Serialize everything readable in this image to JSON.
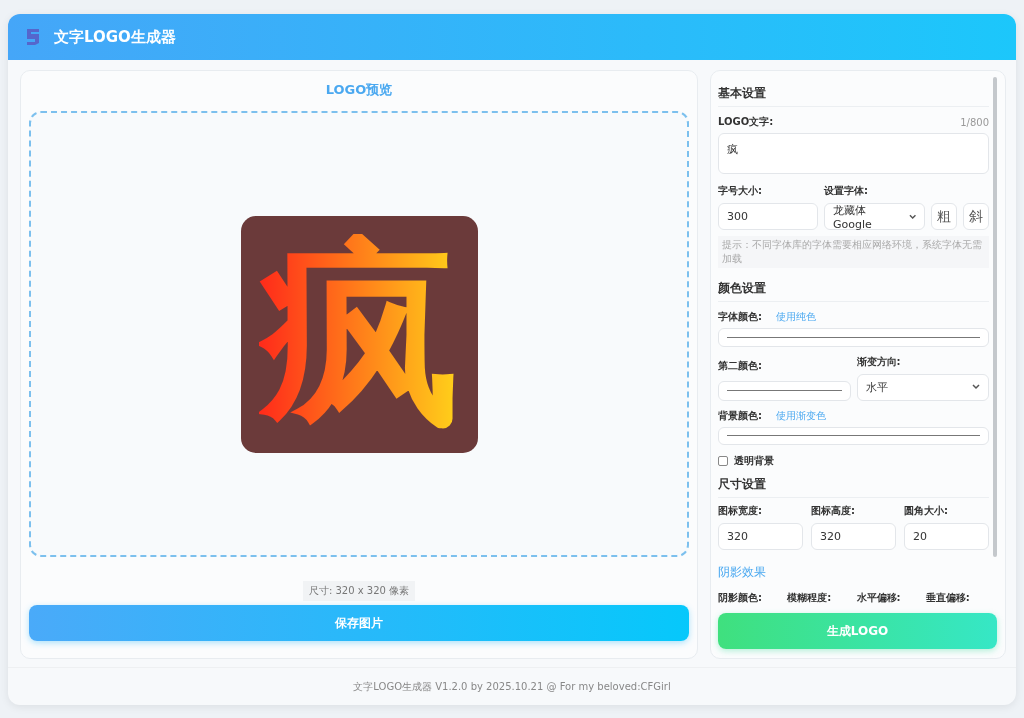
{
  "app": {
    "title": "文字LOGO生成器"
  },
  "preview": {
    "title": "LOGO预览",
    "text": "疯",
    "size_label": "尺寸: 320 x 320 像素",
    "save_button": "保存图片"
  },
  "basic": {
    "heading": "基本设置",
    "text_label": "LOGO文字:",
    "counter": "1/800",
    "text_value": "疯",
    "size_label": "字号大小:",
    "size_value": "300",
    "font_label": "设置字体:",
    "font_value": "龙藏体 Google",
    "bold_button": "粗",
    "italic_button": "斜",
    "hint": "提示：不同字体库的字体需要相应网络环境，系统字体无需加载"
  },
  "color": {
    "heading": "颜色设置",
    "font_color_label": "字体颜色:",
    "font_color_link": "使用纯色",
    "second_color_label": "第二颜色:",
    "direction_label": "渐变方向:",
    "direction_value": "水平",
    "bg_color_label": "背景颜色:",
    "bg_color_link": "使用渐变色",
    "transparent": {
      "label": "透明背景",
      "checked": false
    }
  },
  "size": {
    "heading": "尺寸设置",
    "fields": [
      {
        "label": "图标宽度:",
        "value": "320"
      },
      {
        "label": "图标高度:",
        "value": "320"
      },
      {
        "label": "圆角大小:",
        "value": "20"
      }
    ]
  },
  "shadow": {
    "heading": "阴影效果",
    "labels": [
      "阴影颜色:",
      "模糊程度:",
      "水平偏移:",
      "垂直偏移:"
    ]
  },
  "generate_button": "生成LOGO",
  "footer": "文字LOGO生成器 V1.2.0 by 2025.10.21 @ For my beloved:CFGirl"
}
